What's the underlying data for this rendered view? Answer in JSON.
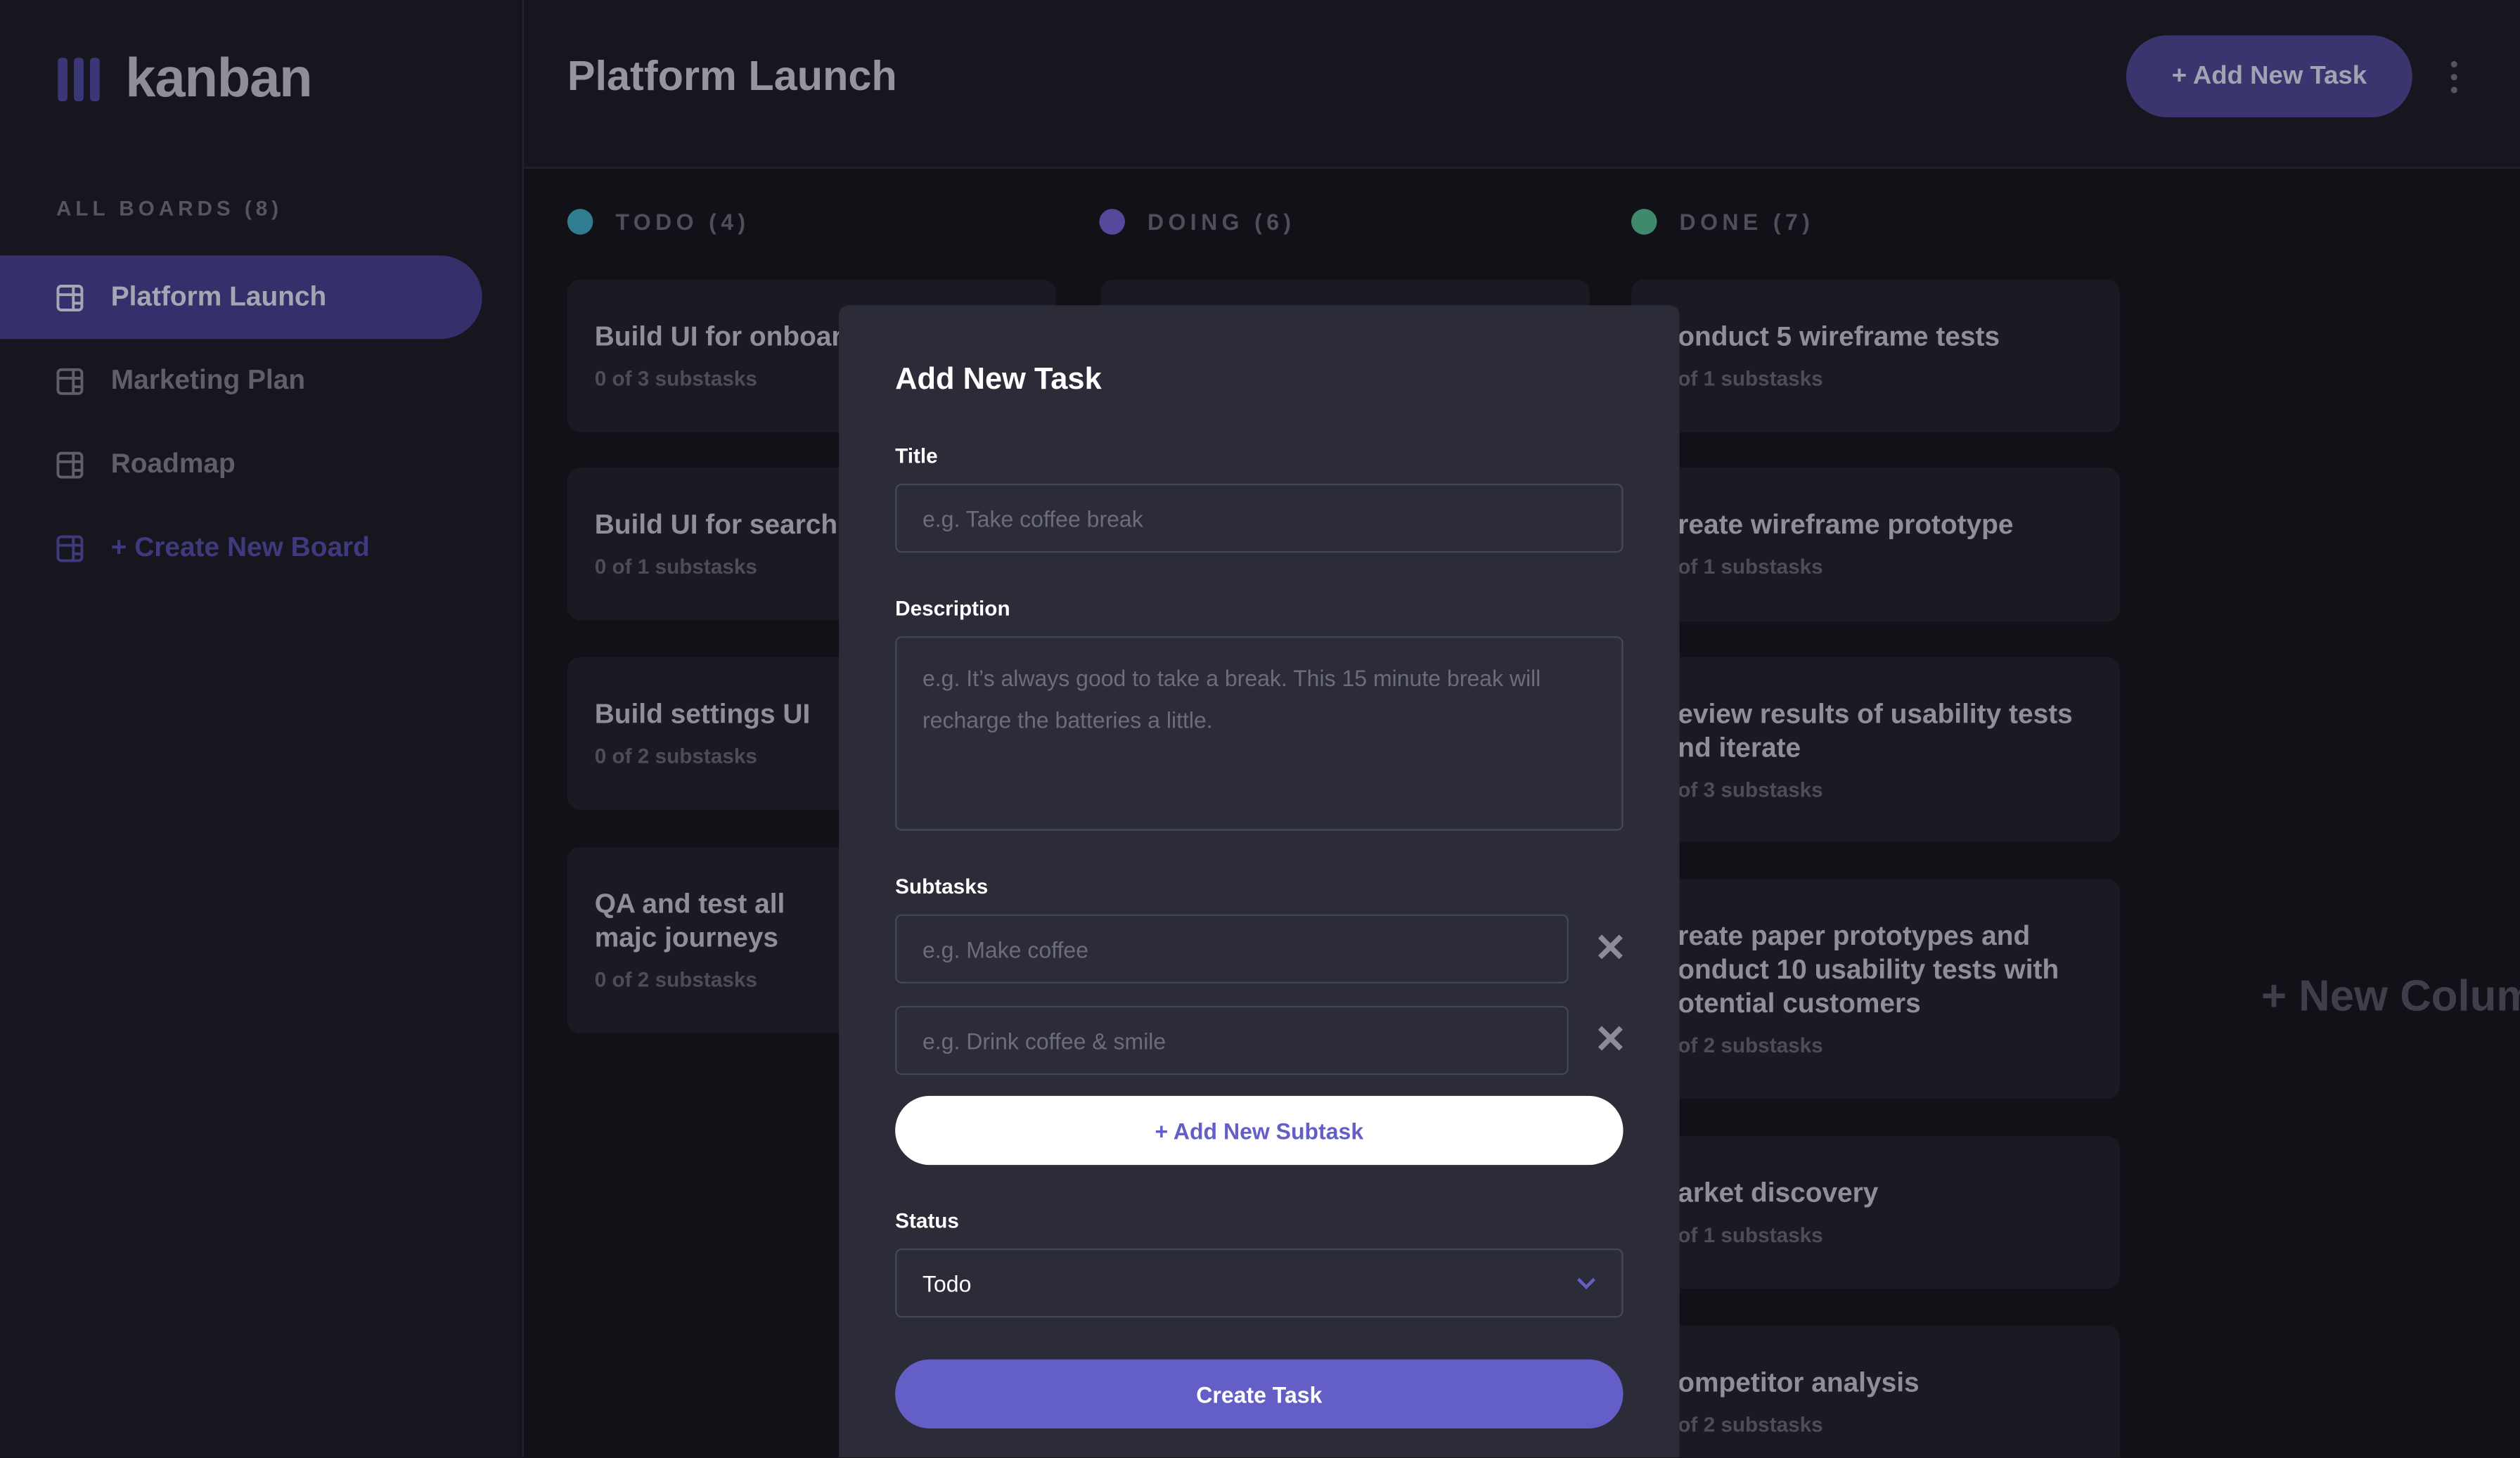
{
  "app": {
    "logo": "kanban"
  },
  "sidebar": {
    "heading": "ALL BOARDS (8)",
    "items": [
      {
        "label": "Platform Launch",
        "active": true
      },
      {
        "label": "Marketing Plan"
      },
      {
        "label": "Roadmap"
      }
    ],
    "create": "+ Create New Board"
  },
  "header": {
    "title": "Platform Launch",
    "add_task": "+ Add New Task",
    "menu_icon": "vertical-ellipsis-icon"
  },
  "colors": {
    "accent": "#635fc7",
    "todo": "#49c4e5",
    "doing": "#8471f2",
    "done": "#67e2ae"
  },
  "columns": [
    {
      "name": "TODO (4)",
      "cards": [
        {
          "title": "Build UI for onboard",
          "subtasks": "0 of 3 substasks"
        },
        {
          "title": "Build UI for search",
          "subtasks": "0 of 1 substasks"
        },
        {
          "title": "Build settings UI",
          "subtasks": "0 of 2 substasks"
        },
        {
          "title": "QA and test all majc journeys",
          "subtasks": "0 of 2 substasks"
        }
      ]
    },
    {
      "name": "DOING (6)",
      "cards": []
    },
    {
      "name": "DONE (7)",
      "cards": [
        {
          "title": "onduct 5 wireframe tests",
          "subtasks": "of 1 substasks"
        },
        {
          "title": "reate wireframe prototype",
          "subtasks": "of 1 substasks"
        },
        {
          "title": "eview results of usability tests nd iterate",
          "subtasks": "of 3 substasks"
        },
        {
          "title": "reate paper prototypes and onduct 10 usability tests with otential customers",
          "subtasks": "of 2 substasks"
        },
        {
          "title": "arket discovery",
          "subtasks": "of 1 substasks"
        },
        {
          "title": "ompetitor analysis",
          "subtasks": "of 2 substasks"
        }
      ]
    }
  ],
  "new_column": "+ New Colum",
  "modal": {
    "title": "Add New Task",
    "title_label": "Title",
    "title_placeholder": "e.g. Take coffee break",
    "desc_label": "Description",
    "desc_placeholder": "e.g. It’s always good to take a break. This 15 minute break will recharge the batteries a little.",
    "subtasks_label": "Subtasks",
    "subtasks": [
      {
        "placeholder": "e.g. Make coffee"
      },
      {
        "placeholder": "e.g. Drink coffee & smile"
      }
    ],
    "add_subtask": "+ Add New Subtask",
    "status_label": "Status",
    "status_value": "Todo",
    "create": "Create Task"
  }
}
